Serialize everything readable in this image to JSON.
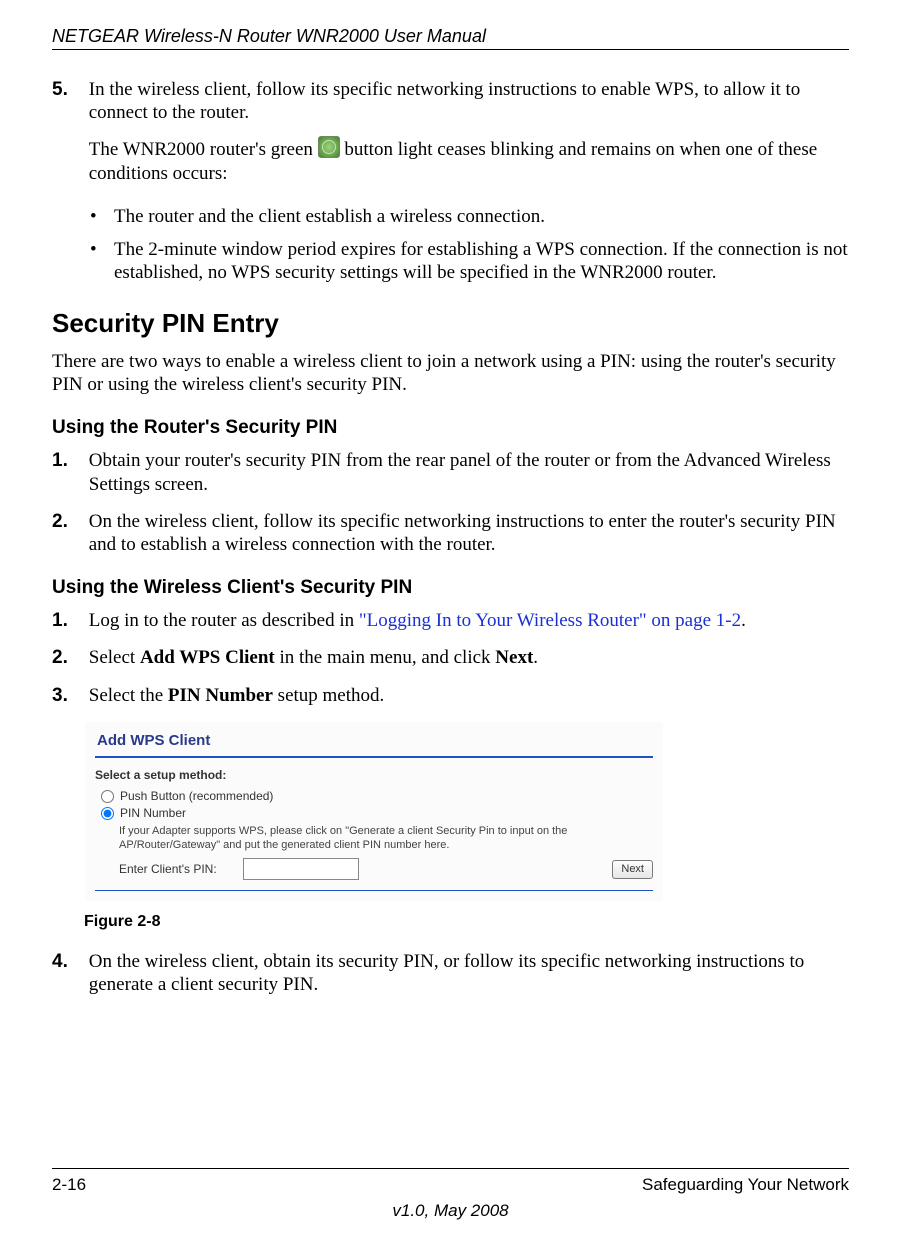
{
  "header": {
    "title": "NETGEAR Wireless-N Router WNR2000 User Manual"
  },
  "step5": {
    "num": "5.",
    "text": "In the wireless client, follow its specific networking instructions to enable WPS, to allow it to connect to the router.",
    "para_before": "The WNR2000 router's green ",
    "para_after": " button light ceases blinking and remains on when one of these conditions occurs:",
    "bullets": [
      "The router and the client establish a wireless connection.",
      "The 2-minute window period expires for establishing a WPS connection. If the connection is not established, no WPS security settings will be specified in the WNR2000 router."
    ]
  },
  "section": {
    "title": "Security PIN Entry",
    "intro": "There are two ways to enable a wireless client to join a network using a PIN: using the router's security PIN or using the wireless client's security PIN."
  },
  "router_pin": {
    "heading": "Using the Router's Security PIN",
    "steps": [
      {
        "num": "1.",
        "text": "Obtain your router's security PIN from the rear panel of the router or from the Advanced Wireless Settings screen."
      },
      {
        "num": "2.",
        "text": "On the wireless client, follow its specific networking instructions to enter the router's security PIN and to establish a wireless connection with the router."
      }
    ]
  },
  "client_pin": {
    "heading": "Using the Wireless Client's Security PIN",
    "step1": {
      "num": "1.",
      "pre": "Log in to the router as described in ",
      "link": "\"Logging In to Your Wireless Router\" on page 1-2",
      "post": "."
    },
    "step2": {
      "num": "2.",
      "pre": "Select ",
      "b1": "Add WPS Client",
      "mid": " in the main menu, and click ",
      "b2": "Next",
      "post": "."
    },
    "step3": {
      "num": "3.",
      "pre": "Select the ",
      "b": "PIN Number",
      "post": " setup method."
    },
    "step4": {
      "num": "4.",
      "text": "On the wireless client, obtain its security PIN, or follow its specific networking instructions to generate a client security PIN."
    }
  },
  "figure": {
    "title": "Add WPS Client",
    "select_label": "Select a setup method:",
    "radio_push": "Push Button (recommended)",
    "radio_pin": "PIN Number",
    "note": "If your Adapter supports WPS, please click on \"Generate a client Security Pin to input on the AP/Router/Gateway\" and put the generated client PIN number here.",
    "enter_label": "Enter Client's PIN:",
    "next": "Next",
    "caption": "Figure 2-8"
  },
  "footer": {
    "page": "2-16",
    "right": "Safeguarding Your Network",
    "version": "v1.0, May 2008"
  }
}
